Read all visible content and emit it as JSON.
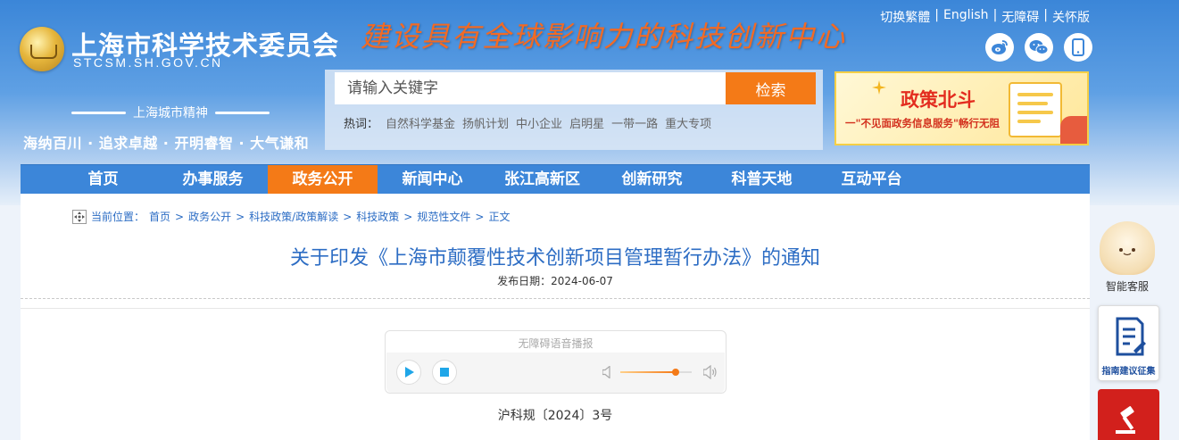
{
  "header": {
    "site_title": "上海市科学技术委员会",
    "site_domain": "STCSM.SH.GOV.CN",
    "slogan": "建设具有全球影响力的科技创新中心",
    "top_links": [
      "切换繁體",
      "English",
      "无障碍",
      "关怀版"
    ],
    "social": [
      {
        "icon": "weibo-icon"
      },
      {
        "icon": "wechat-icon"
      },
      {
        "icon": "mobile-icon"
      }
    ],
    "spirit_title": "上海城市精神",
    "spirit_words": "海纳百川 · 追求卓越 · 开明睿智 · 大气谦和"
  },
  "search": {
    "placeholder": "请输入关键字",
    "button_label": "检索",
    "hot_label": "热词：",
    "hot_words": [
      "自然科学基金",
      "扬帆计划",
      "中小企业",
      "启明星",
      "一带一路",
      "重大专项"
    ]
  },
  "banner": {
    "title": "政策北斗",
    "subtitle": "一\"不见面政务信息服务\"畅行无阻"
  },
  "nav": {
    "items": [
      "首页",
      "办事服务",
      "政务公开",
      "新闻中心",
      "张江高新区",
      "创新研究",
      "科普天地",
      "互动平台"
    ],
    "active_index": 2
  },
  "breadcrumb": {
    "label": "当前位置：",
    "items": [
      "首页",
      "政务公开",
      "科技政策/政策解读",
      "科技政策",
      "规范性文件",
      "正文"
    ]
  },
  "article": {
    "title": "关于印发《上海市颠覆性技术创新项目管理暂行办法》的通知",
    "date_label": "发布日期：",
    "date": "2024-06-07",
    "doc_number": "沪科规〔2024〕3号"
  },
  "audio": {
    "label": "无障碍语音播报",
    "volume_level": 0.78
  },
  "floaters": {
    "service_label": "智能客服",
    "guide_label": "指南建议征集"
  },
  "colors": {
    "primary_blue": "#3c86d9",
    "accent_orange": "#f47a17",
    "title_blue": "#2d6dc4"
  }
}
